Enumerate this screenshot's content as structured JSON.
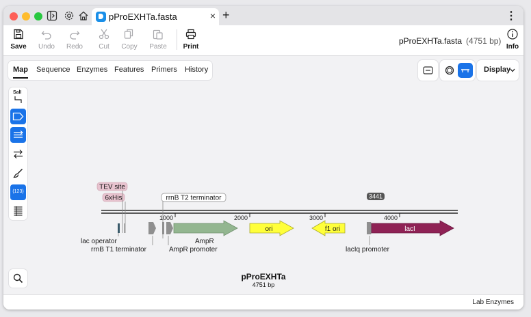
{
  "tab": {
    "title": "pProEXHTa.fasta",
    "close": "×",
    "new": "+"
  },
  "toolbar": {
    "save": "Save",
    "undo": "Undo",
    "redo": "Redo",
    "cut": "Cut",
    "copy": "Copy",
    "paste": "Paste",
    "print": "Print",
    "info": "Info",
    "filename": "pProEXHTa.fasta",
    "size": "(4751 bp)"
  },
  "views": [
    "Map",
    "Sequence",
    "Enzymes",
    "Features",
    "Primers",
    "History"
  ],
  "display_label": "Display",
  "palette": {
    "sall": "SalI",
    "numbers": "(123)"
  },
  "map": {
    "name": "pProEXHTa",
    "length": "4751 bp",
    "ticks": [
      "1000",
      "2000",
      "3000",
      "4000"
    ],
    "badge": "3441",
    "features": {
      "ampr": "AmpR",
      "ori": "ori",
      "f1ori": "f1 ori",
      "laci": "lacI",
      "tev": "TEV site",
      "his": "6xHis",
      "rrnb_t2": "rrnB T2 terminator",
      "lac_operator": "lac operator",
      "rrnb_t1": "rrnB T1 terminator",
      "ampr_promoter": "AmpR promoter",
      "laciq_promoter": "lacIq promoter"
    }
  },
  "status": {
    "lab_enzymes": "Lab Enzymes"
  },
  "colors": {
    "accent": "#1a73e8",
    "ampr": "#93b690",
    "ori": "#ffff3a",
    "f1ori": "#ffff3a",
    "laci": "#8f2255",
    "tev": "#e8c3cf",
    "misc": "#a5a5a5"
  }
}
